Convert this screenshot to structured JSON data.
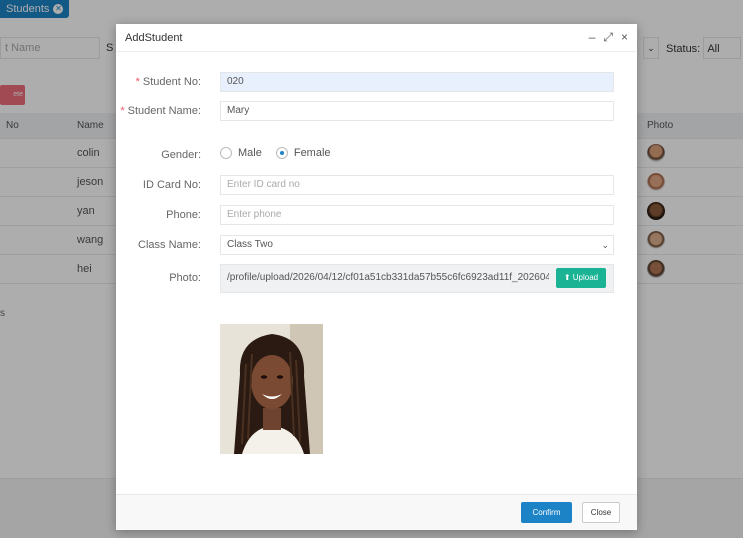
{
  "background": {
    "tab_label": "Students",
    "search_placeholder": "t Name",
    "search2_label": "S",
    "status_label": "Status:",
    "status_value": "All",
    "delete_label": "ete",
    "columns": {
      "no": "No",
      "name": "Name",
      "photo": "Photo"
    },
    "rows": [
      {
        "name": "colin"
      },
      {
        "name": "jeson"
      },
      {
        "name": "yan"
      },
      {
        "name": "wang"
      },
      {
        "name": "hei"
      }
    ],
    "footer_text": "s"
  },
  "modal": {
    "title": "AddStudent",
    "tools": {
      "minimize": "–",
      "maximize": "⤢",
      "close": "×"
    },
    "fields": {
      "student_no": {
        "label": "Student No:",
        "value": "020"
      },
      "student_name": {
        "label": "Student Name:",
        "value": "Mary"
      },
      "gender": {
        "label": "Gender:",
        "options": [
          "Male",
          "Female"
        ],
        "selected": "Female"
      },
      "id_card_no": {
        "label": "ID Card No:",
        "placeholder": "Enter ID card no"
      },
      "phone": {
        "label": "Phone:",
        "placeholder": "Enter phone"
      },
      "class_name": {
        "label": "Class Name:",
        "value": "Class Two"
      },
      "photo": {
        "label": "Photo:",
        "path": "/profile/upload/2026/04/12/cf01a51cb331da57b55c6fc6923ad11f_2026041",
        "upload_label": "Upload"
      }
    },
    "buttons": {
      "confirm": "Confirm",
      "close": "Close"
    }
  },
  "colors": {
    "primary": "#1c84c6",
    "success": "#1ab394",
    "danger": "#ed5565"
  }
}
